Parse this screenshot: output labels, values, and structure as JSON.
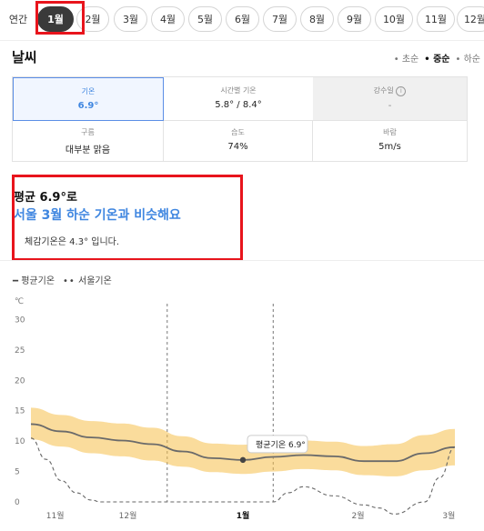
{
  "months": [
    "연간",
    "1월",
    "2월",
    "3월",
    "4월",
    "5월",
    "6월",
    "7월",
    "8월",
    "9월",
    "10월",
    "11월",
    "12월"
  ],
  "active_month": "1월",
  "weather": {
    "title": "날씨",
    "tabs": [
      "초순",
      "중순",
      "하순"
    ],
    "active_tab": "중순",
    "cells": [
      {
        "label": "기온",
        "value": "6.9°"
      },
      {
        "label": "시간별 기온",
        "value": "5.8° / 8.4°"
      },
      {
        "label": "강수일",
        "value": "-"
      },
      {
        "label": "구름",
        "value": "대부분 맑음"
      },
      {
        "label": "습도",
        "value": "74%"
      },
      {
        "label": "바람",
        "value": "5m/s"
      }
    ]
  },
  "summary": {
    "title": "평균 6.9°로",
    "subtitle": "서울 3월 하순 기온과 비슷해요",
    "note": "체감기온은 4.3° 입니다."
  },
  "legend": [
    {
      "name": "평균기온",
      "style": "solid"
    },
    {
      "name": "서울기온",
      "style": "dotted"
    }
  ],
  "chart_data": {
    "type": "line",
    "ylabel": "℃",
    "ylim": [
      0,
      35
    ],
    "yticks": [
      0,
      5,
      10,
      15,
      20,
      25,
      30
    ],
    "xtick_labels": [
      "11월",
      "12월",
      "1월",
      "2월",
      "3월"
    ],
    "bold_xtick": "1월",
    "tooltip": "평균기온 6.9°",
    "series": [
      {
        "name": "평균기온",
        "color": "#666666",
        "x": [
          0,
          1,
          2,
          3,
          4,
          5,
          6,
          7,
          8,
          9,
          10,
          11,
          12,
          13,
          14
        ],
        "values": [
          12.8,
          11.6,
          10.6,
          10.1,
          9.5,
          8.3,
          7.2,
          6.9,
          7.4,
          7.7,
          7.5,
          6.7,
          6.7,
          8.0,
          9.0
        ]
      },
      {
        "name": "범위 상단",
        "color": "#f5c04a",
        "x": [
          0,
          1,
          2,
          3,
          4,
          5,
          6,
          7,
          8,
          9,
          10,
          11,
          12,
          13,
          14
        ],
        "values": [
          15.5,
          14.3,
          13.3,
          12.9,
          12.2,
          10.8,
          9.6,
          9.4,
          9.9,
          10.1,
          9.9,
          9.2,
          9.5,
          11.0,
          12.0
        ]
      },
      {
        "name": "범위 하단",
        "color": "#f5c04a",
        "x": [
          0,
          1,
          2,
          3,
          4,
          5,
          6,
          7,
          8,
          9,
          10,
          11,
          12,
          13,
          14
        ],
        "values": [
          10.3,
          9.1,
          8.0,
          7.5,
          6.8,
          5.8,
          4.9,
          4.6,
          5.0,
          5.4,
          5.2,
          4.4,
          4.2,
          5.2,
          6.0
        ]
      },
      {
        "name": "서울기온",
        "color": "#666666",
        "x": [
          0,
          0.5,
          1,
          1.5,
          2,
          2.3,
          2.6,
          8,
          8.5,
          9,
          10,
          11,
          11.5,
          12,
          13,
          13.5,
          14
        ],
        "values": [
          10.5,
          7,
          3.5,
          1.5,
          0.3,
          0,
          0,
          0,
          1.5,
          2.5,
          1,
          -0.5,
          -1,
          -2,
          0,
          4,
          9
        ]
      }
    ],
    "xtick_positions": [
      0.8,
      3.2,
      7,
      10.8,
      13.8
    ],
    "dashed_x": [
      4.5,
      8.0
    ],
    "grid": false
  }
}
